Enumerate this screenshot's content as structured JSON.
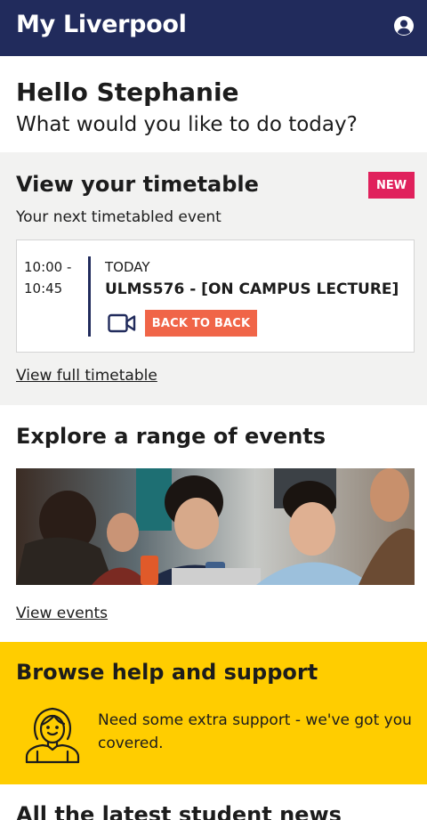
{
  "app": {
    "title": "My Liverpool",
    "account_icon": "user-circle-icon"
  },
  "greeting": {
    "hello": "Hello Stephanie",
    "prompt": "What would you like to do today?"
  },
  "timetable": {
    "title": "View your timetable",
    "badge": "NEW",
    "next_label": "Your next timetabled event",
    "event": {
      "time_start": "10:00 -",
      "time_end": "10:45",
      "day": "TODAY",
      "name": "ULMS576 - [ON CAMPUS LECTURE]",
      "mode_icon": "video-camera-icon",
      "tag": "BACK TO BACK"
    },
    "link": "View full timetable"
  },
  "events": {
    "title": "Explore a range of events",
    "link": "View events"
  },
  "support": {
    "title": "Browse help and support",
    "icon": "person-smiling-icon",
    "text": "Need some extra support - we've got you covered."
  },
  "news": {
    "title": "All the latest student news"
  },
  "colors": {
    "header_bg": "#212b5c",
    "badge_new": "#e0215c",
    "back_to_back": "#f06548",
    "support_bg": "#ffcd00",
    "timetable_bg": "#f2f2f1"
  }
}
